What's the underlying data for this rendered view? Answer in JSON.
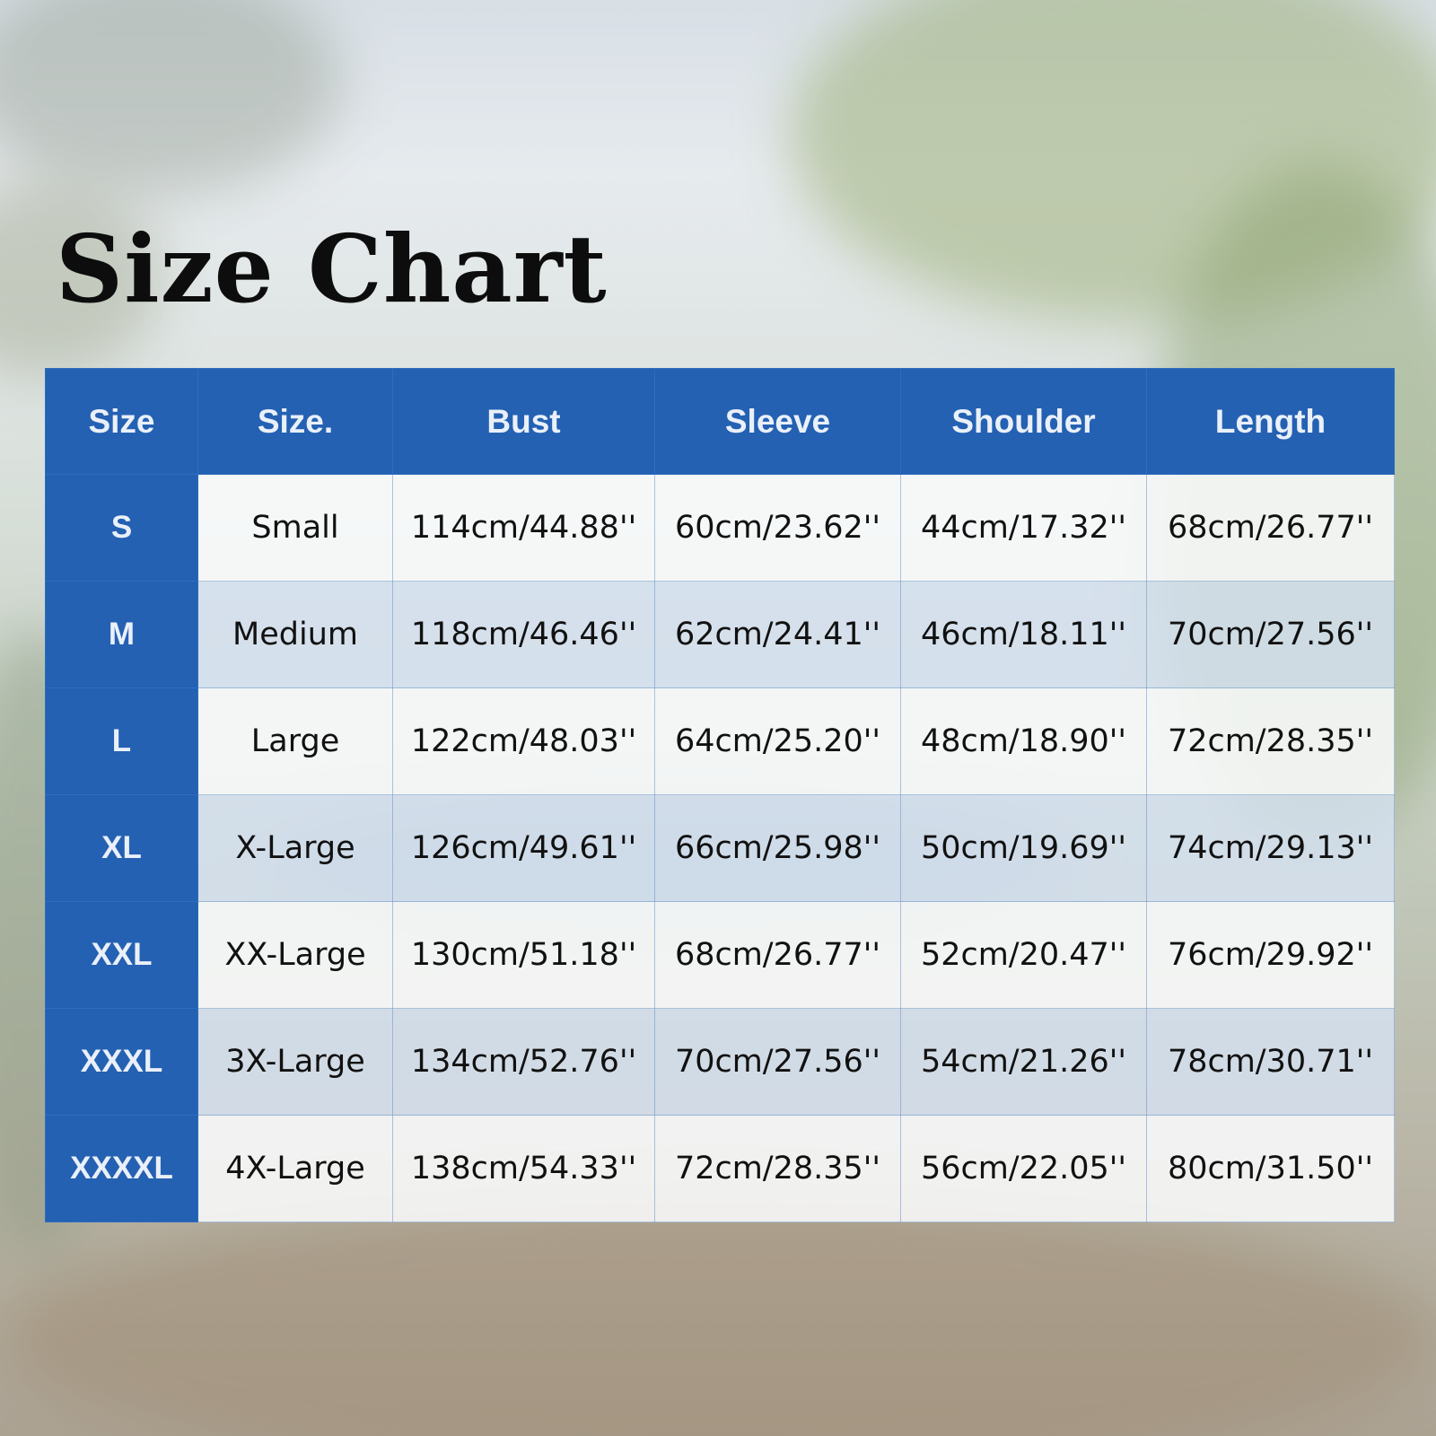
{
  "title": "Size Chart",
  "colors": {
    "header_blue": "#2461b3",
    "header_text": "#eaf0f8",
    "row_light": "#fafbfd",
    "row_tint": "#d6e2f2"
  },
  "table": {
    "headers": [
      "Size",
      "Size.",
      "Bust",
      "Sleeve",
      "Shoulder",
      "Length"
    ],
    "rows": [
      [
        "S",
        "Small",
        "114cm/44.88''",
        "60cm/23.62''",
        "44cm/17.32''",
        "68cm/26.77''"
      ],
      [
        "M",
        "Medium",
        "118cm/46.46''",
        "62cm/24.41''",
        "46cm/18.11''",
        "70cm/27.56''"
      ],
      [
        "L",
        "Large",
        "122cm/48.03''",
        "64cm/25.20''",
        "48cm/18.90''",
        "72cm/28.35''"
      ],
      [
        "XL",
        "X-Large",
        "126cm/49.61''",
        "66cm/25.98''",
        "50cm/19.69''",
        "74cm/29.13''"
      ],
      [
        "XXL",
        "XX-Large",
        "130cm/51.18''",
        "68cm/26.77''",
        "52cm/20.47''",
        "76cm/29.92''"
      ],
      [
        "XXXL",
        "3X-Large",
        "134cm/52.76''",
        "70cm/27.56''",
        "54cm/21.26''",
        "78cm/30.71''"
      ],
      [
        "XXXXL",
        "4X-Large",
        "138cm/54.33''",
        "72cm/28.35''",
        "56cm/22.05''",
        "80cm/31.50''"
      ]
    ]
  }
}
